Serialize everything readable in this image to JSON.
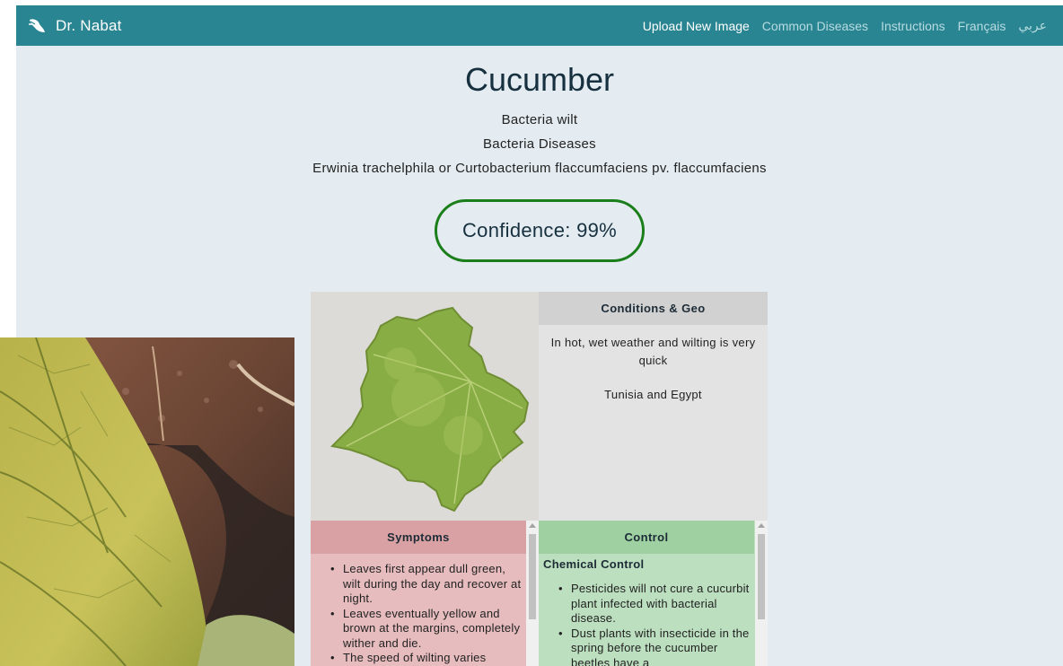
{
  "navbar": {
    "brand": "Dr. Nabat",
    "links": [
      "Upload New Image",
      "Common Diseases",
      "Instructions",
      "Français",
      "عربي"
    ]
  },
  "result": {
    "crop": "Cucumber",
    "disease": "Bacteria wilt",
    "category": "Bacteria Diseases",
    "pathogen": "Erwinia trachelphila or Curtobacterium flaccumfaciens pv. flaccumfaciens",
    "confidence": "Confidence: 99%"
  },
  "conditions": {
    "title": "Conditions & Geo",
    "text": "In hot, wet weather and wilting is very quick",
    "geo": "Tunisia and Egypt"
  },
  "symptoms": {
    "title": "Symptoms",
    "items": [
      "Leaves first appear dull green, wilt during the day and recover at night.",
      "Leaves eventually yellow and brown at the margins, completely wither and die.",
      "The speed of wilting varies"
    ]
  },
  "control": {
    "title": "Control",
    "subtitle": "Chemical Control",
    "items": [
      "Pesticides will not cure a cucurbit plant infected with bacterial disease.",
      "Dust plants with insecticide in the spring before the cucumber beetles have a"
    ]
  },
  "colors": {
    "navbar": "#2a8592",
    "page_bg": "#e4ecf1",
    "confidence_border": "#1a7f1a",
    "symptoms_bg": "#e7bcbe",
    "control_bg": "#bcdfbf",
    "conditions_bg": "#e3e3e3"
  },
  "icons": {
    "brand": "leaf-icon"
  }
}
